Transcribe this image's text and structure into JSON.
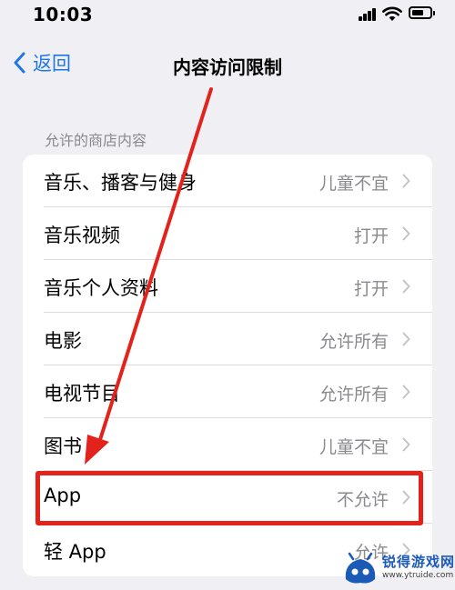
{
  "status_bar": {
    "time": "10:03"
  },
  "nav": {
    "back_label": "返回",
    "title": "内容访问限制"
  },
  "section": {
    "header": "允许的商店内容"
  },
  "rows": [
    {
      "label": "音乐、播客与健身",
      "value": "儿童不宜"
    },
    {
      "label": "音乐视频",
      "value": "打开"
    },
    {
      "label": "音乐个人资料",
      "value": "打开"
    },
    {
      "label": "电影",
      "value": "允许所有"
    },
    {
      "label": "电视节目",
      "value": "允许所有"
    },
    {
      "label": "图书",
      "value": "儿童不宜"
    },
    {
      "label": "App",
      "value": "不允许"
    },
    {
      "label": "轻 App",
      "value": "允许"
    }
  ],
  "annotation": {
    "highlighted_row": "App",
    "color": "#e3231b"
  },
  "watermark": {
    "name": "锐得游戏网",
    "url": "www.ytruide.com"
  },
  "colors": {
    "accent": "#1f77e6",
    "background": "#f0eff4",
    "secondary_text": "#8a8a8e"
  }
}
